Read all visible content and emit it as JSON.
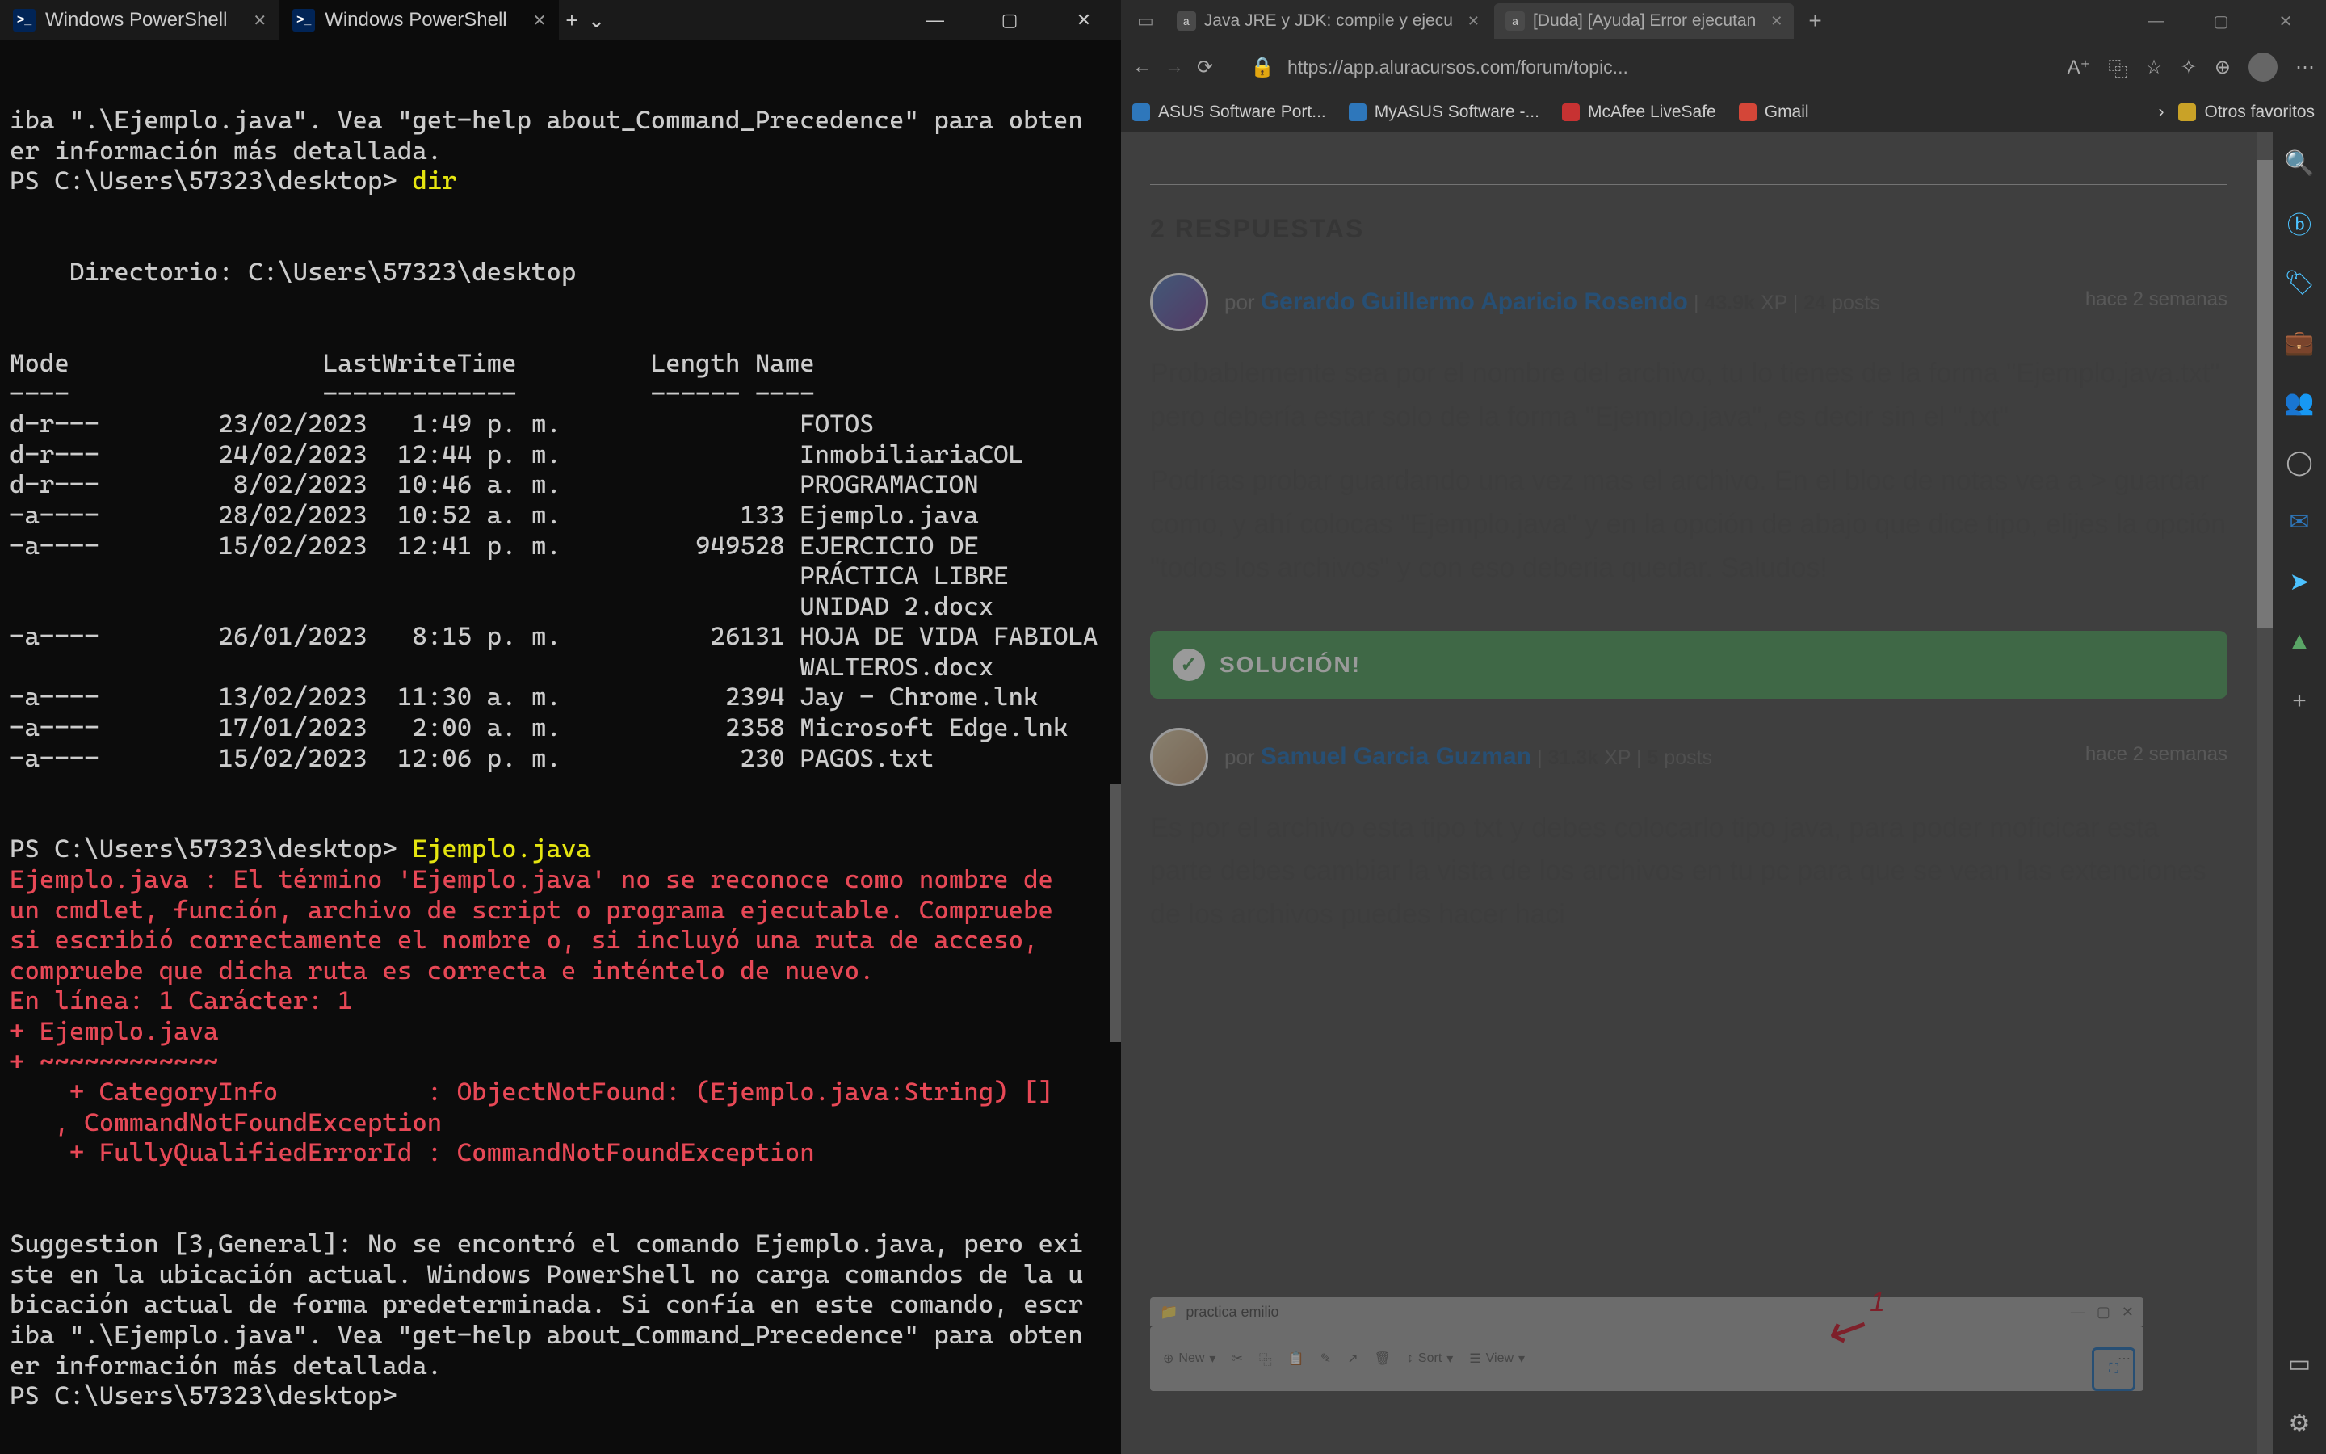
{
  "terminal": {
    "tabs": [
      {
        "title": "Windows PowerShell",
        "active": false
      },
      {
        "title": "Windows PowerShell",
        "active": true
      }
    ],
    "lines": [
      {
        "cls": "white",
        "text": "iba \".\\Ejemplo.java\". Vea \"get-help about_Command_Precedence\" para obten"
      },
      {
        "cls": "white",
        "text": "er información más detallada."
      },
      {
        "cls": "prompt",
        "prompt": "PS C:\\Users\\57323\\desktop> ",
        "cmd": "dir"
      },
      {
        "cls": "white",
        "text": ""
      },
      {
        "cls": "white",
        "text": ""
      },
      {
        "cls": "white",
        "text": "    Directorio: C:\\Users\\57323\\desktop"
      },
      {
        "cls": "white",
        "text": ""
      },
      {
        "cls": "white",
        "text": ""
      },
      {
        "cls": "white",
        "text": "Mode                 LastWriteTime         Length Name"
      },
      {
        "cls": "white",
        "text": "----                 -------------         ------ ----"
      },
      {
        "cls": "white",
        "text": "d-r---        23/02/2023   1:49 p. m.                FOTOS"
      },
      {
        "cls": "white",
        "text": "d-r---        24/02/2023  12:44 p. m.                InmobiliariaCOL"
      },
      {
        "cls": "white",
        "text": "d-r---         8/02/2023  10:46 a. m.                PROGRAMACION"
      },
      {
        "cls": "white",
        "text": "-a----        28/02/2023  10:52 a. m.            133 Ejemplo.java"
      },
      {
        "cls": "white",
        "text": "-a----        15/02/2023  12:41 p. m.         949528 EJERCICIO DE"
      },
      {
        "cls": "white",
        "text": "                                                     PRÁCTICA LIBRE"
      },
      {
        "cls": "white",
        "text": "                                                     UNIDAD 2.docx"
      },
      {
        "cls": "white",
        "text": "-a----        26/01/2023   8:15 p. m.          26131 HOJA DE VIDA FABIOLA"
      },
      {
        "cls": "white",
        "text": "                                                     WALTEROS.docx"
      },
      {
        "cls": "white",
        "text": "-a----        13/02/2023  11:30 a. m.           2394 Jay - Chrome.lnk"
      },
      {
        "cls": "white",
        "text": "-a----        17/01/2023   2:00 a. m.           2358 Microsoft Edge.lnk"
      },
      {
        "cls": "white",
        "text": "-a----        15/02/2023  12:06 p. m.            230 PAGOS.txt"
      },
      {
        "cls": "white",
        "text": ""
      },
      {
        "cls": "white",
        "text": ""
      },
      {
        "cls": "prompt",
        "prompt": "PS C:\\Users\\57323\\desktop> ",
        "cmd": "Ejemplo.java"
      },
      {
        "cls": "red",
        "text": "Ejemplo.java : El término 'Ejemplo.java' no se reconoce como nombre de"
      },
      {
        "cls": "red",
        "text": "un cmdlet, función, archivo de script o programa ejecutable. Compruebe"
      },
      {
        "cls": "red",
        "text": "si escribió correctamente el nombre o, si incluyó una ruta de acceso,"
      },
      {
        "cls": "red",
        "text": "compruebe que dicha ruta es correcta e inténtelo de nuevo."
      },
      {
        "cls": "red",
        "text": "En línea: 1 Carácter: 1"
      },
      {
        "cls": "red",
        "text": "+ Ejemplo.java"
      },
      {
        "cls": "red",
        "text": "+ ~~~~~~~~~~~~"
      },
      {
        "cls": "red",
        "text": "    + CategoryInfo          : ObjectNotFound: (Ejemplo.java:String) []"
      },
      {
        "cls": "red",
        "text": "   , CommandNotFoundException"
      },
      {
        "cls": "red",
        "text": "    + FullyQualifiedErrorId : CommandNotFoundException"
      },
      {
        "cls": "white",
        "text": ""
      },
      {
        "cls": "white",
        "text": ""
      },
      {
        "cls": "white",
        "text": "Suggestion [3,General]: No se encontró el comando Ejemplo.java, pero exi"
      },
      {
        "cls": "white",
        "text": "ste en la ubicación actual. Windows PowerShell no carga comandos de la u"
      },
      {
        "cls": "white",
        "text": "bicación actual de forma predeterminada. Si confía en este comando, escr"
      },
      {
        "cls": "white",
        "text": "iba \".\\Ejemplo.java\". Vea \"get-help about_Command_Precedence\" para obten"
      },
      {
        "cls": "white",
        "text": "er información más detallada."
      },
      {
        "cls": "prompt",
        "prompt": "PS C:\\Users\\57323\\desktop> ",
        "cmd": ""
      }
    ]
  },
  "browser": {
    "tabs": [
      {
        "title": "Java JRE y JDK: compile y ejecu",
        "active": false
      },
      {
        "title": "[Duda] [Ayuda] Error ejecutan",
        "active": true
      }
    ],
    "new_tab": "+",
    "url": "https://app.aluracursos.com/forum/topic...",
    "bookmarks": [
      {
        "label": "ASUS Software Port...",
        "color": "blue"
      },
      {
        "label": "MyASUS Software -...",
        "color": "blue"
      },
      {
        "label": "McAfee LiveSafe",
        "color": "red"
      },
      {
        "label": "Gmail",
        "color": "gm"
      }
    ],
    "bookmarks_more": "›",
    "other_favs": "Otros favoritos"
  },
  "page": {
    "responses_title": "2 RESPUESTAS",
    "solution_label": "SOLUCIÓN!",
    "replies": [
      {
        "time": "hace 2 semanas",
        "by": "por ",
        "author": "Gerardo Guillermo Aparicio Rosendo",
        "xp_num": "43.9k",
        "xp_label": " XP | ",
        "posts_num": "24",
        "posts_label": " posts",
        "body": [
          "Probablemente sea por el nombre del archivo, tu lo tienes de la forma \"Ejemplo.java.txt\" pero debería estar solo de la forma \"Ejemplo.java\", es decir sin el \".txt\"",
          "Podrías probar guardando una vez mas el archivo. En el bloc de notas vea a > guardar como, y ahí colocas \"Ejemplo.java\" y en la opción de abajo que dice tipo, elijes la opción \"todos los archivos\" y con eso deberia quedar. Saludos!"
        ]
      },
      {
        "time": "hace 2 semanas",
        "by": "por ",
        "author": "Samuel Garcia Guzman",
        "xp_num": "31.3k",
        "xp_label": " XP | ",
        "posts_num": "5",
        "posts_label": " posts",
        "body": [
          "Es por el archivo esta tipo txt y debes colocarlo tipo java, para poder moficicar esta parte debes cambiar la vista de los archivos en tu pc para que se vean las extenciones de los archivos puedes hacer haci"
        ]
      }
    ],
    "file_explorer": {
      "title": "practica emilio",
      "buttons": {
        "new": "New",
        "sort": "Sort",
        "view": "View"
      }
    },
    "annotation_num": "1"
  }
}
